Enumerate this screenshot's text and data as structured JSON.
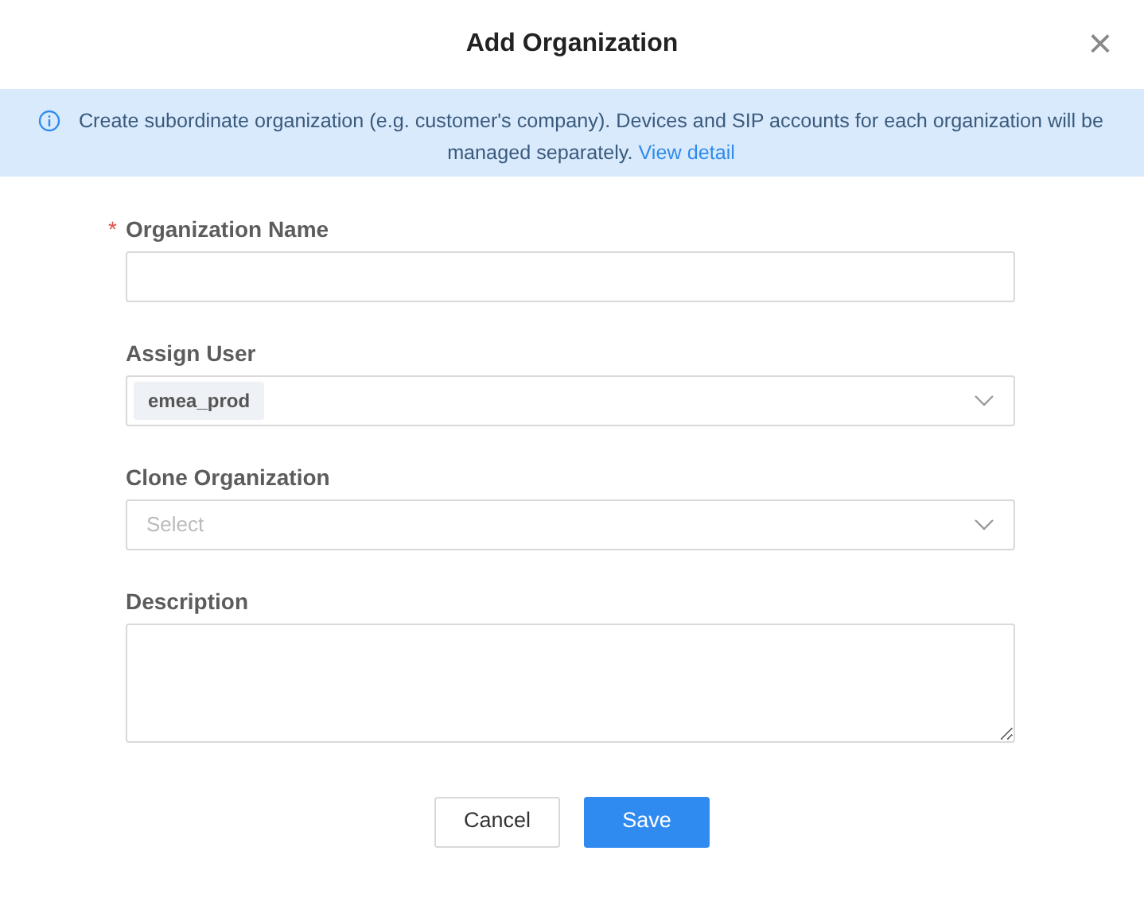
{
  "dialog": {
    "title": "Add Organization",
    "close": "×"
  },
  "notice": {
    "text": "Create subordinate organization (e.g. customer's company). Devices and SIP accounts for each organization will be managed separately.",
    "link": "View detail"
  },
  "fields": [
    {
      "kind": "text",
      "label": "Organization Name",
      "required_mark": "*"
    },
    {
      "kind": "tag-select",
      "label": "Assign User",
      "tags": [
        "emea_prod"
      ]
    },
    {
      "kind": "select",
      "label": "Clone Organization",
      "placeholder": "Select"
    },
    {
      "kind": "textarea",
      "label": "Description"
    }
  ],
  "buttons": [
    {
      "label": "Cancel",
      "primary": false
    },
    {
      "label": "Save",
      "primary": true
    }
  ]
}
